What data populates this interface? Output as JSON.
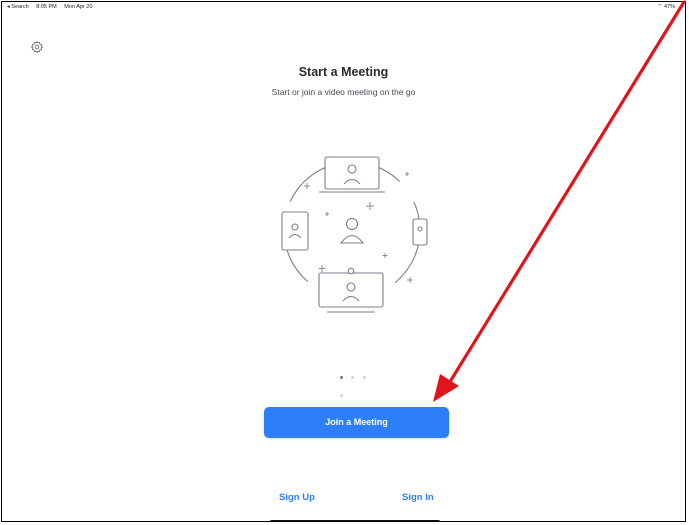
{
  "status_bar": {
    "back_label": "◂ Search",
    "time": "8:05 PM",
    "date": "Mon Apr 20",
    "battery": "47%"
  },
  "header": {
    "title": "Start a Meeting",
    "subtitle": "Start or join a video meeting on the go"
  },
  "illustration": {
    "icon": "devices-connection-illustration"
  },
  "pagination": {
    "count": 4,
    "active": 1
  },
  "actions": {
    "join_label": "Join a Meeting",
    "signup_label": "Sign Up",
    "signin_label": "Sign In"
  },
  "colors": {
    "accent": "#2d7ff9",
    "annotation_arrow": "#e0141b",
    "illustration_stroke": "#7a7f8e"
  }
}
